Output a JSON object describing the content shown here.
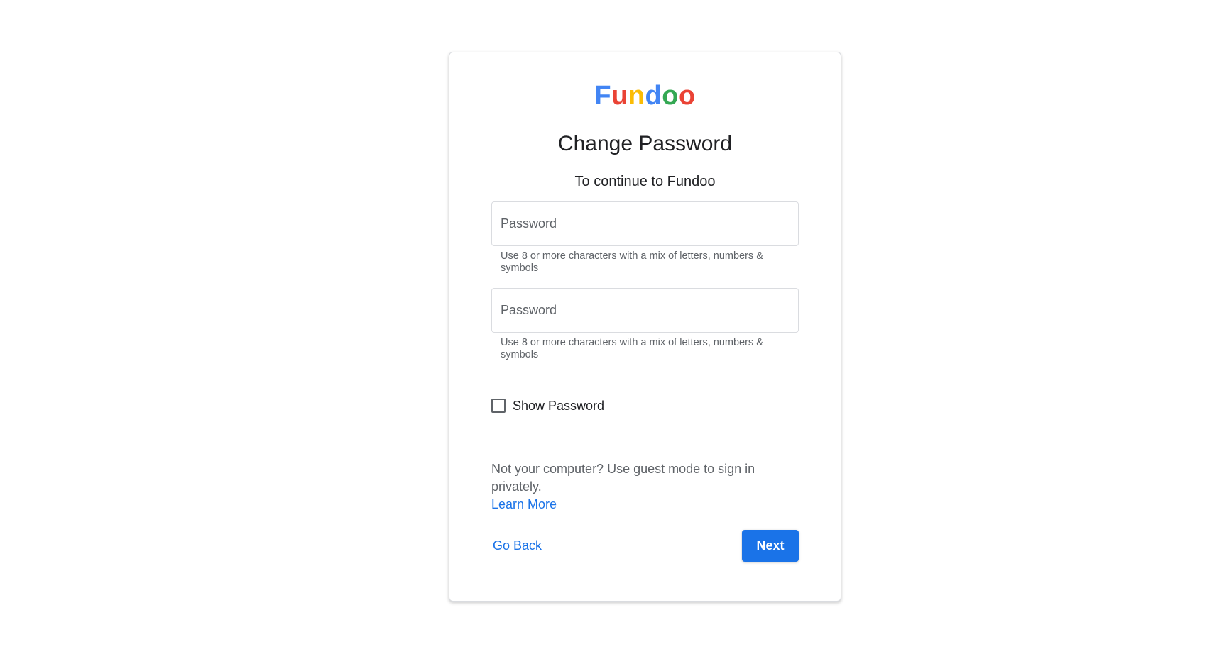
{
  "logo": {
    "letters": [
      {
        "char": "F",
        "color": "#4285f4"
      },
      {
        "char": "u",
        "color": "#ea4335"
      },
      {
        "char": "n",
        "color": "#fbbc05"
      },
      {
        "char": "d",
        "color": "#4285f4"
      },
      {
        "char": "o",
        "color": "#34a853"
      },
      {
        "char": "o",
        "color": "#ea4335"
      }
    ]
  },
  "title": "Change Password",
  "subtitle": "To continue to Fundoo",
  "fields": [
    {
      "placeholder": "Password",
      "value": "",
      "hint": "Use 8 or more characters with a mix of letters, numbers & symbols"
    },
    {
      "placeholder": "Password",
      "value": "",
      "hint": "Use 8 or more characters with a mix of letters, numbers & symbols"
    }
  ],
  "show_password": {
    "label": "Show Password",
    "checked": false
  },
  "guest_notice": {
    "text": "Not your computer? Use guest mode to sign in privately.",
    "link_label": "Learn More"
  },
  "actions": {
    "back_label": "Go Back",
    "next_label": "Next"
  },
  "colors": {
    "accent": "#1a73e8",
    "text": "#202124",
    "muted": "#5f6368",
    "border": "#dadce0"
  }
}
